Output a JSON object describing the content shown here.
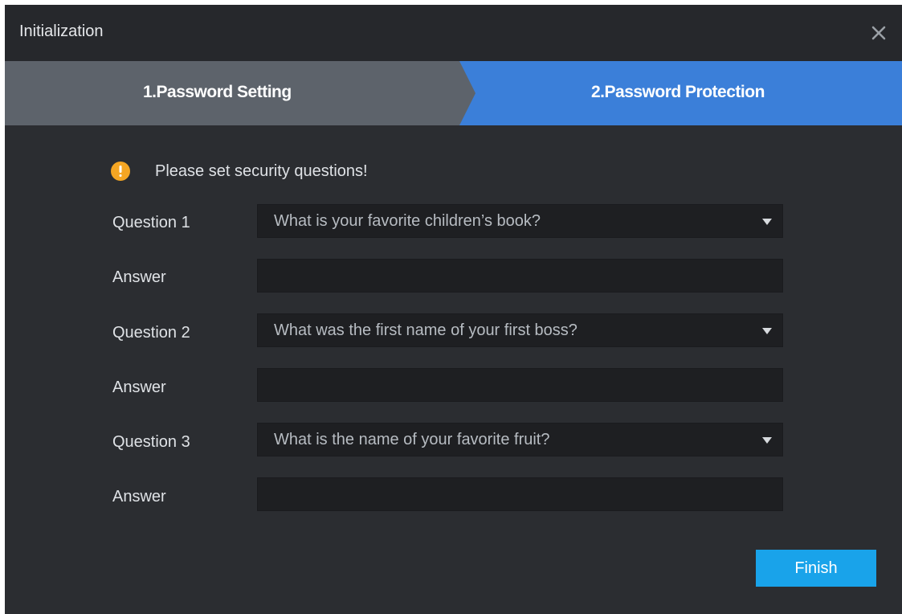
{
  "window": {
    "title": "Initialization",
    "close_icon": "close-icon"
  },
  "steps": [
    {
      "label": "1.Password Setting",
      "state": "completed"
    },
    {
      "label": "2.Password Protection",
      "state": "active"
    }
  ],
  "notice": {
    "icon": "warning-icon",
    "icon_color": "#f5a623",
    "text": "Please set security questions!"
  },
  "form": {
    "rows": [
      {
        "question_label": "Question 1",
        "question_value": "What is your favorite children’s book?",
        "answer_label": "Answer",
        "answer_value": ""
      },
      {
        "question_label": "Question 2",
        "question_value": "What was the first name of your first boss?",
        "answer_label": "Answer",
        "answer_value": ""
      },
      {
        "question_label": "Question 3",
        "question_value": "What is the name of your favorite fruit?",
        "answer_label": "Answer",
        "answer_value": ""
      }
    ]
  },
  "actions": {
    "finish_label": "Finish"
  },
  "colors": {
    "background": "#2b2d31",
    "step_inactive": "#5d636b",
    "step_active": "#3b7fd9",
    "primary_button": "#19a3ea"
  }
}
